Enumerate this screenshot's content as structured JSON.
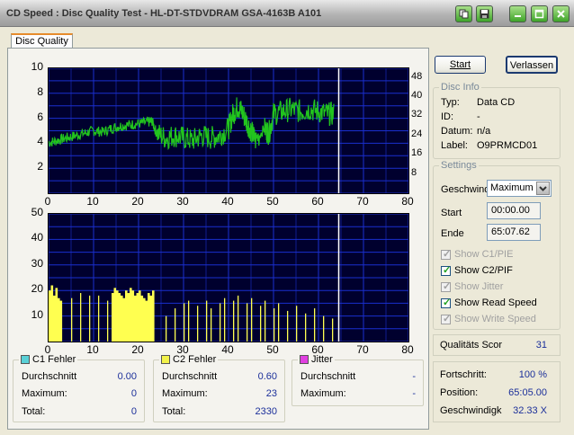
{
  "window": {
    "title": "CD Speed : Disc Quality Test - HL-DT-STDVDRAM GSA-4163B A101"
  },
  "titlebar_icons": [
    "copy-icon",
    "save-icon",
    "minimize-icon",
    "maximize-icon",
    "close-icon"
  ],
  "tab": {
    "label": "Disc Quality"
  },
  "top_chart": {
    "y_ticks": [
      "10",
      "8",
      "6",
      "4",
      "2"
    ],
    "y2_ticks": [
      "48",
      "40",
      "32",
      "24",
      "16",
      "8"
    ],
    "x_ticks": [
      "0",
      "10",
      "20",
      "30",
      "40",
      "50",
      "60",
      "70",
      "80"
    ]
  },
  "bottom_chart": {
    "y_ticks": [
      "50",
      "40",
      "30",
      "20",
      "10"
    ],
    "x_ticks": [
      "0",
      "10",
      "20",
      "30",
      "40",
      "50",
      "60",
      "70",
      "80"
    ]
  },
  "chart_data": [
    {
      "type": "line",
      "xlim": [
        0,
        80
      ],
      "ylim": [
        0,
        10
      ],
      "y2lim": [
        0,
        52
      ],
      "grid": true,
      "cursor_x": 64.5,
      "series": [
        {
          "axis": "right",
          "color": "#22C41E",
          "x": [
            0,
            2,
            4,
            6,
            8,
            10,
            12,
            14,
            16,
            18,
            20,
            22,
            23,
            24,
            26,
            28,
            30,
            32,
            34,
            36,
            38,
            40,
            41,
            42,
            43,
            44,
            45,
            46,
            48,
            49,
            50,
            52,
            54,
            56,
            58,
            60,
            62,
            63.5
          ],
          "y": [
            21,
            22,
            23,
            24,
            25,
            26,
            25.5,
            27,
            28,
            28.5,
            29,
            29.5,
            30,
            25,
            23,
            24,
            23,
            22,
            24,
            23,
            24,
            27,
            33,
            36,
            34,
            30,
            26,
            22,
            27,
            25,
            33,
            34,
            35,
            34,
            35,
            34,
            33,
            33
          ]
        }
      ]
    },
    {
      "type": "bar",
      "xlim": [
        0,
        80
      ],
      "ylim": [
        0,
        50
      ],
      "grid": true,
      "cursor_x": 64.5,
      "series": [
        {
          "name": "C2",
          "color": "#FFFF50",
          "x": [
            0,
            0.5,
            1,
            1.5,
            2,
            2.5,
            5,
            7,
            9,
            11,
            13,
            14,
            14.5,
            15,
            15.5,
            16,
            16.5,
            17,
            17.5,
            18,
            18.5,
            19,
            19.5,
            20,
            20.5,
            21,
            21.5,
            22,
            22.5,
            23,
            26,
            28,
            30,
            31,
            33,
            35,
            36,
            38,
            39,
            41,
            42,
            44,
            45,
            47,
            48,
            50,
            51,
            53,
            55,
            57,
            59,
            61,
            63
          ],
          "y": [
            20,
            22,
            18,
            21,
            17,
            16,
            17,
            19,
            18,
            18,
            16,
            19,
            21,
            20,
            19,
            18,
            17,
            20,
            19,
            21,
            20,
            18,
            19,
            20,
            18,
            17,
            16,
            19,
            18,
            20,
            10,
            13,
            15,
            16,
            14,
            16,
            13,
            15,
            17,
            16,
            18,
            15,
            17,
            14,
            16,
            13,
            15,
            12,
            14,
            11,
            13,
            10,
            9
          ]
        }
      ]
    }
  ],
  "stats": {
    "c1": {
      "title": "C1 Fehler",
      "color": "#59D0D6",
      "avg_label": "Durchschnitt",
      "avg": "0.00",
      "max_label": "Maximum:",
      "max": "0",
      "total_label": "Total:",
      "total": "0"
    },
    "c2": {
      "title": "C2 Fehler",
      "color": "#F2F24A",
      "avg_label": "Durchschnitt",
      "avg": "0.60",
      "max_label": "Maximum:",
      "max": "23",
      "total_label": "Total:",
      "total": "2330"
    },
    "jitter": {
      "title": "Jitter",
      "color": "#E040E0",
      "avg_label": "Durchschnitt",
      "avg": "-",
      "max_label": "Maximum:",
      "max": "-"
    }
  },
  "buttons": {
    "start": "Start",
    "exit": "Verlassen"
  },
  "disc_info": {
    "title": "Disc Info",
    "type_label": "Typ:",
    "type": "Data CD",
    "id_label": "ID:",
    "id": "-",
    "date_label": "Datum:",
    "date": "n/a",
    "label_label": "Label:",
    "label": "O9PRMCD01"
  },
  "settings": {
    "title": "Settings",
    "speed_label": "Geschwind",
    "speed_value": "Maximum",
    "start_label": "Start",
    "start_value": "00:00.00",
    "end_label": "Ende",
    "end_value": "65:07.62",
    "checkboxes": [
      {
        "label": "Show C1/PIE",
        "checked": true,
        "enabled": false
      },
      {
        "label": "Show C2/PIF",
        "checked": true,
        "enabled": true
      },
      {
        "label": "Show Jitter",
        "checked": true,
        "enabled": false
      },
      {
        "label": "Show Read Speed",
        "checked": true,
        "enabled": true
      },
      {
        "label": "Show Write Speed",
        "checked": true,
        "enabled": false
      }
    ]
  },
  "quality": {
    "label": "Qualitäts Scor",
    "value": "31"
  },
  "progress": {
    "fortschritt_label": "Fortschritt:",
    "fortschritt": "100 %",
    "position_label": "Position:",
    "position": "65:05.00",
    "speed_label": "Geschwindigk",
    "speed": "32.33 X"
  }
}
